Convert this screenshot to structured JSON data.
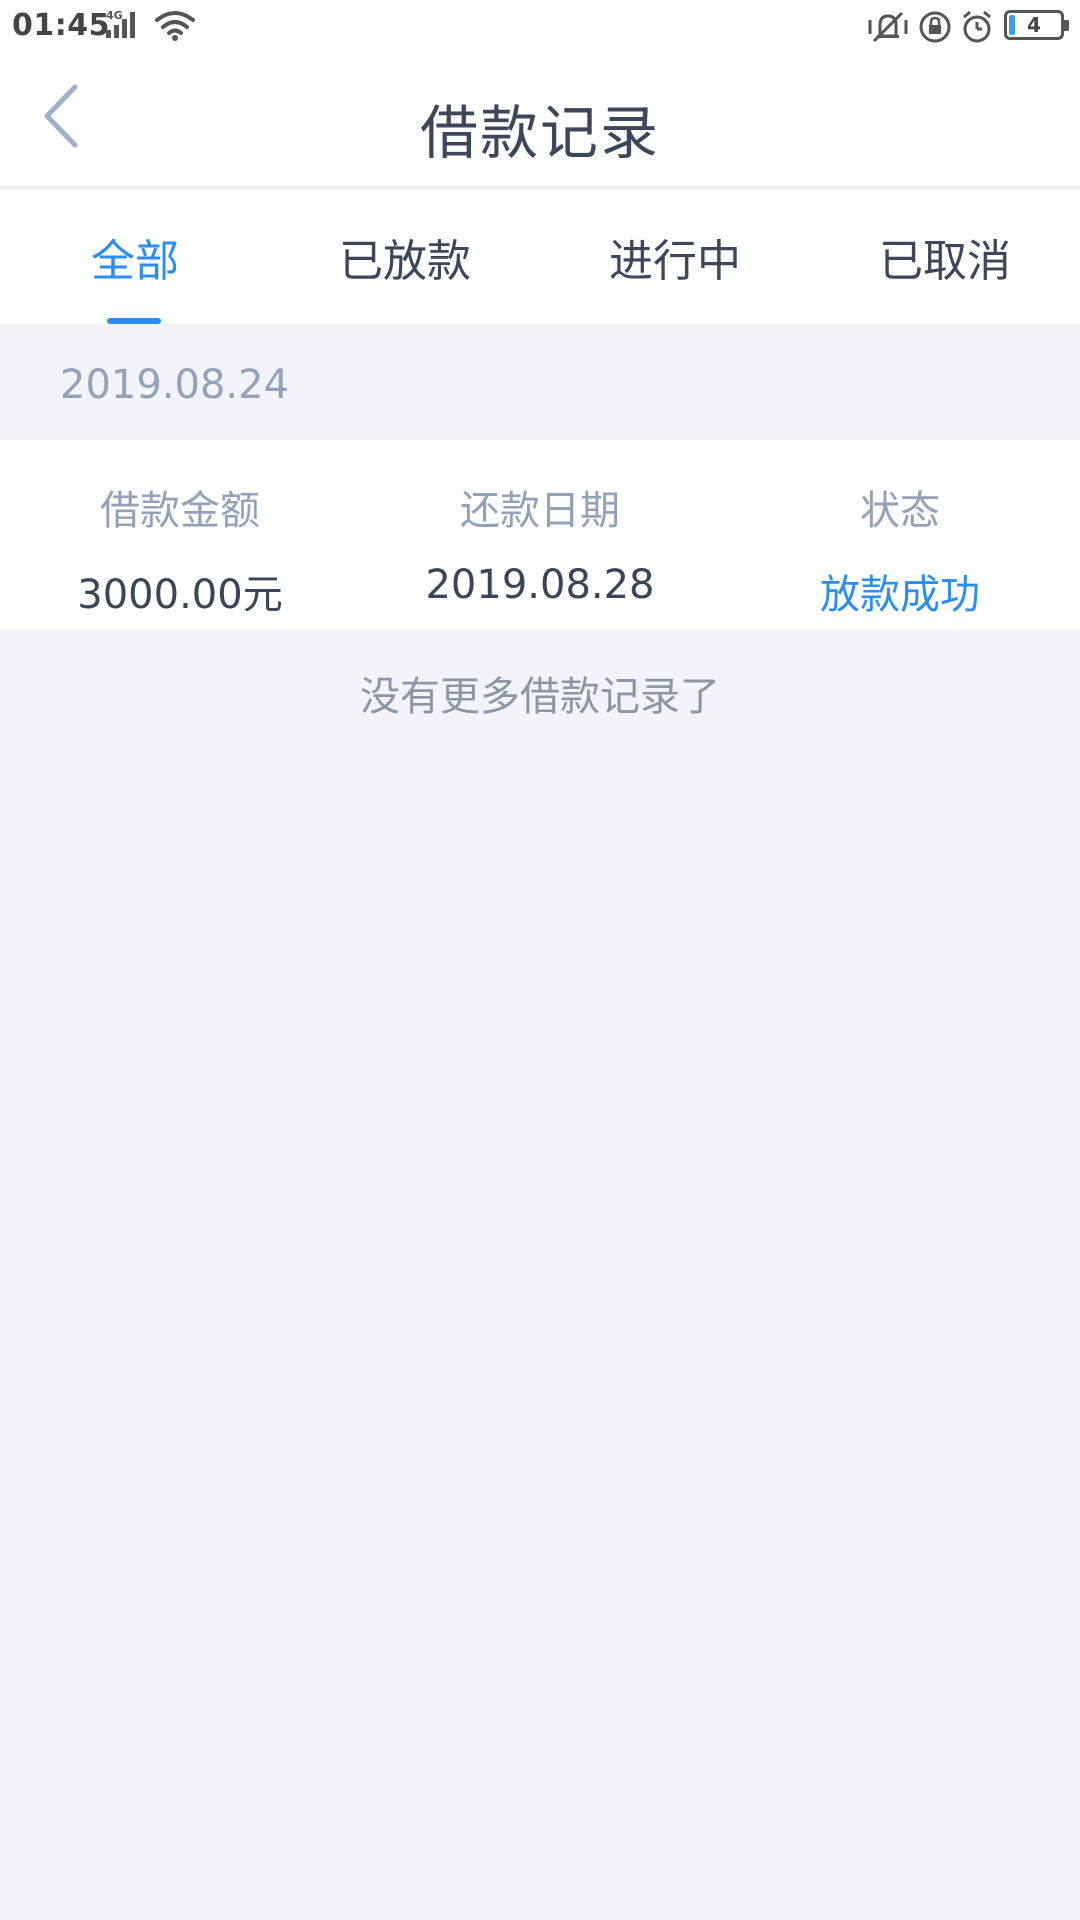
{
  "status_bar": {
    "time": "01:45",
    "network": "4G",
    "battery_level": "4"
  },
  "header": {
    "title": "借款记录",
    "back_icon": "chevron-left-icon"
  },
  "tabs": [
    {
      "label": "全部",
      "active": true
    },
    {
      "label": "已放款",
      "active": false
    },
    {
      "label": "进行中",
      "active": false
    },
    {
      "label": "已取消",
      "active": false
    }
  ],
  "records": [
    {
      "date": "2019.08.24",
      "amount_label": "借款金额",
      "amount_value": "3000.00元",
      "due_label": "还款日期",
      "due_value": "2019.08.28",
      "status_label": "状态",
      "status_value": "放款成功"
    }
  ],
  "footer_note": "没有更多借款记录了",
  "colors": {
    "accent": "#2b8df0",
    "background": "#f2f4f9",
    "label_gray": "#93a2b8",
    "text_dark": "#3a4556"
  }
}
